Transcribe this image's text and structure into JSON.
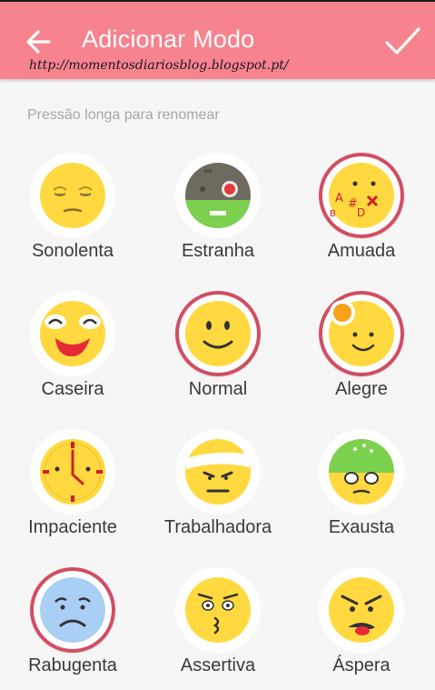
{
  "appbar": {
    "title": "Adicionar Modo",
    "back_icon": "arrow-left-icon",
    "confirm_icon": "checkmark-icon",
    "background": "#f7838f"
  },
  "watermark": "http://momentosdiariosblog.blogspot.pt/",
  "hint": "Pressão longa para renomear",
  "accent": "#d24d63",
  "moods": [
    {
      "label": "Sonolenta",
      "icon": "sleepy-face-icon",
      "selected": false
    },
    {
      "label": "Estranha",
      "icon": "cyborg-face-icon",
      "selected": false
    },
    {
      "label": "Amuada",
      "icon": "grumpy-face-icon",
      "selected": true
    },
    {
      "label": "Caseira",
      "icon": "laughing-face-icon",
      "selected": false
    },
    {
      "label": "Normal",
      "icon": "smiling-face-icon",
      "selected": true
    },
    {
      "label": "Alegre",
      "icon": "happy-face-icon",
      "selected": true
    },
    {
      "label": "Impaciente",
      "icon": "clock-face-icon",
      "selected": false
    },
    {
      "label": "Trabalhadora",
      "icon": "headband-face-icon",
      "selected": false
    },
    {
      "label": "Exausta",
      "icon": "exhausted-face-icon",
      "selected": false
    },
    {
      "label": "Rabugenta",
      "icon": "sad-face-icon",
      "selected": true
    },
    {
      "label": "Assertiva",
      "icon": "kissing-face-icon",
      "selected": false
    },
    {
      "label": "Áspera",
      "icon": "angry-face-icon",
      "selected": false
    }
  ]
}
